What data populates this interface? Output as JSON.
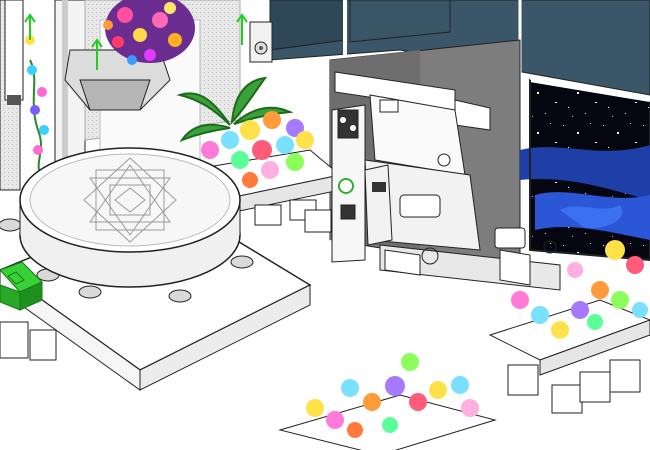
{
  "scene": {
    "description_visible_text": "",
    "elements": [
      "hanging-flower-basket",
      "teleporter-platform",
      "lathe-machine",
      "control-cabinet",
      "flower-planter-left",
      "flower-planter-right",
      "flower-planter-bottom",
      "palm-plant",
      "space-window",
      "green-arrow-indicators",
      "green-cube-item"
    ]
  },
  "colors": {
    "window_frame": "#2f4858",
    "space": "#05060f",
    "nebula": "#1e3fa8",
    "wall_gray": "#8a8a8a",
    "floor": "#ffffff",
    "arrow_green": "#22cc22",
    "cube_green": "#2fbf2f"
  }
}
